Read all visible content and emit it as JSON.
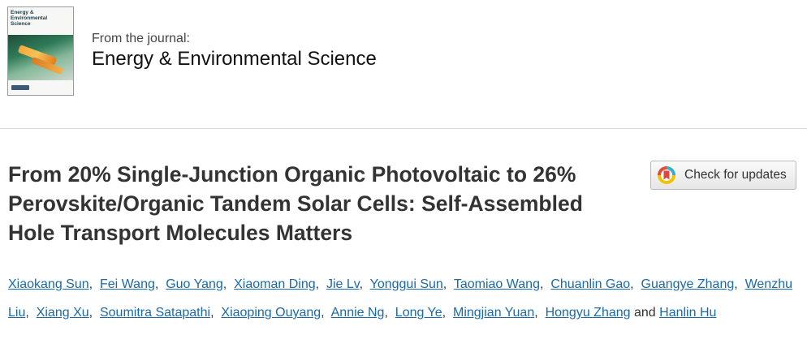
{
  "journal": {
    "cover_title": "Energy & Environmental Science",
    "from_label": "From the journal:",
    "name": "Energy & Environmental Science"
  },
  "article": {
    "title": "From 20% Single-Junction Organic Photovoltaic to 26% Perovskite/Organic Tandem Solar Cells: Self-Assembled Hole Transport Molecules Matters"
  },
  "updates_button": {
    "label": "Check for updates"
  },
  "authors": [
    "Xiaokang Sun",
    "Fei Wang",
    "Guo Yang",
    "Xiaoman Ding",
    "Jie Lv",
    "Yonggui Sun",
    "Taomiao Wang",
    "Chuanlin Gao",
    "Guangye Zhang",
    "Wenzhu Liu",
    "Xiang Xu",
    "Soumitra Satapathi",
    "Xiaoping Ouyang",
    "Annie Ng",
    "Long Ye",
    "Mingjian Yuan",
    "Hongyu Zhang",
    "Hanlin Hu"
  ],
  "authors_conjunction": "and"
}
